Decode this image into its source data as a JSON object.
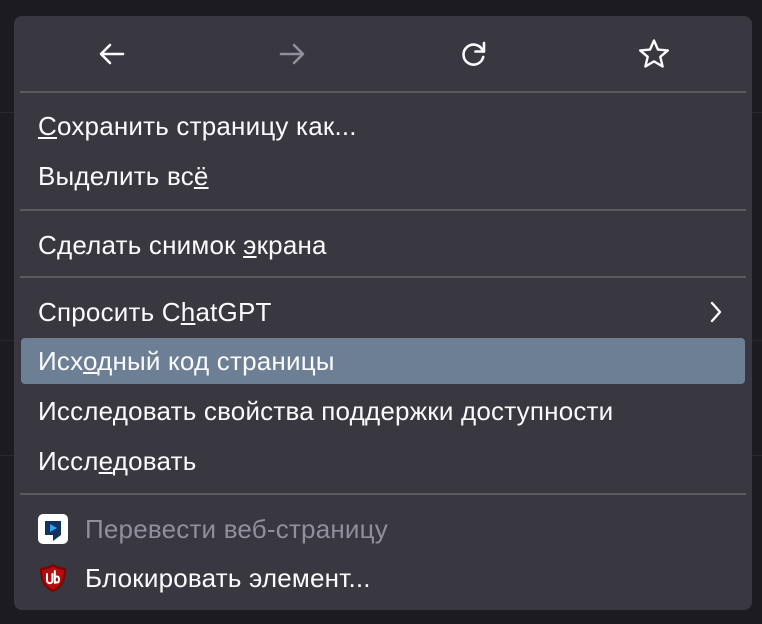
{
  "nav": {
    "back_icon": "arrow-left-icon",
    "forward_icon": "arrow-right-icon",
    "reload_icon": "reload-icon",
    "bookmark_icon": "star-icon"
  },
  "colors": {
    "menu_bg": "#39373f",
    "highlight": "#6c7f94",
    "text": "#fbfbfe",
    "disabled_text": "#8f8f9d",
    "separator": "#5b5a61"
  },
  "menu": {
    "save_page": {
      "before": "",
      "accel": "С",
      "after": "охранить страницу как..."
    },
    "select_all": {
      "before": "Выделить вс",
      "accel": "ё",
      "after": ""
    },
    "screenshot": {
      "before": "Сделать снимок ",
      "accel": "э",
      "after": "крана"
    },
    "ask_chatgpt": {
      "before": "Спросить C",
      "accel": "h",
      "after": "atGPT",
      "submenu_icon": "chevron-right-icon"
    },
    "view_source": {
      "before": "Исх",
      "accel": "о",
      "after": "дный код страницы"
    },
    "inspect_accessibility": {
      "label": "Исследовать свойства поддержки доступности"
    },
    "inspect": {
      "before": "Иссл",
      "accel": "е",
      "after": "довать"
    },
    "translate": {
      "label": "Перевести веб-страницу",
      "icon": "translate-extension-icon"
    },
    "block_element": {
      "label": "Блокировать элемент...",
      "icon": "ublock-origin-icon"
    }
  }
}
